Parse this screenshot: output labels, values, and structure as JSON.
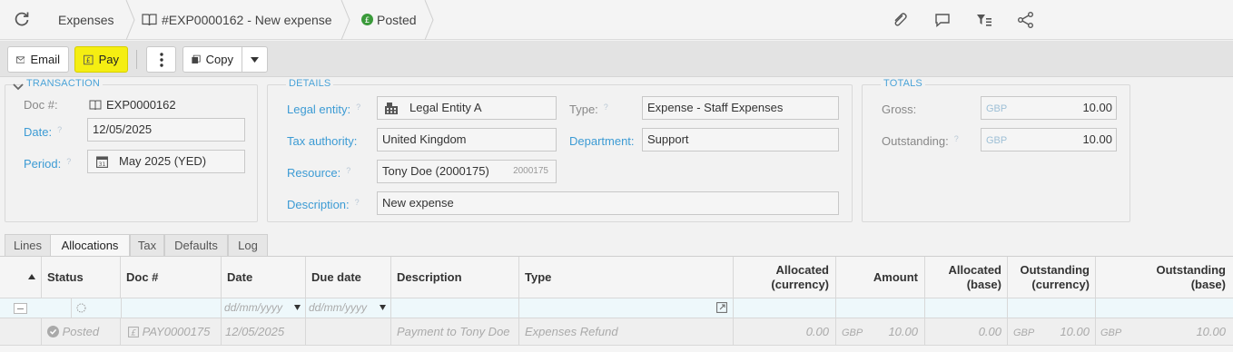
{
  "breadcrumb": {
    "section": "Expenses",
    "document": "#EXP0000162 - New expense",
    "status": "Posted"
  },
  "toolbar": {
    "email_label": "Email",
    "pay_label": "Pay",
    "copy_label": "Copy"
  },
  "transaction": {
    "legend": "TRANSACTION",
    "doc_label": "Doc #:",
    "doc_value": "EXP0000162",
    "date_label": "Date:",
    "date_value": "12/05/2025",
    "period_label": "Period:",
    "period_value": "May 2025 (YED)"
  },
  "details": {
    "legend": "DETAILS",
    "legal_entity_label": "Legal entity:",
    "legal_entity_value": "Legal Entity A",
    "tax_authority_label": "Tax authority:",
    "tax_authority_value": "United Kingdom",
    "resource_label": "Resource:",
    "resource_value": "Tony Doe (2000175)",
    "resource_code": "2000175",
    "description_label": "Description:",
    "description_value": "New expense",
    "type_label": "Type:",
    "type_value": "Expense - Staff Expenses",
    "department_label": "Department:",
    "department_value": "Support"
  },
  "totals": {
    "legend": "TOTALS",
    "gross_label": "Gross:",
    "gross_currency": "GBP",
    "gross_value": "10.00",
    "outstanding_label": "Outstanding:",
    "outstanding_currency": "GBP",
    "outstanding_value": "10.00"
  },
  "tabs": [
    "Lines",
    "Allocations",
    "Tax",
    "Defaults",
    "Log"
  ],
  "grid": {
    "headers": {
      "status": "Status",
      "doc": "Doc #",
      "date": "Date",
      "due_date": "Due date",
      "description": "Description",
      "type": "Type",
      "alloc_cur_1": "Allocated",
      "alloc_cur_2": "(currency)",
      "amount": "Amount",
      "alloc_base_1": "Allocated",
      "alloc_base_2": "(base)",
      "out_cur_1": "Outstanding",
      "out_cur_2": "(currency)",
      "out_base_1": "Outstanding",
      "out_base_2": "(base)"
    },
    "filter": {
      "date_placeholder": "dd/mm/yyyy",
      "due_placeholder": "dd/mm/yyyy"
    },
    "row": {
      "status": "Posted",
      "doc": "PAY0000175",
      "date": "12/05/2025",
      "description": "Payment to Tony Doe",
      "type": "Expenses Refund",
      "allocated_currency": "0.00",
      "amount_currency": "GBP",
      "amount": "10.00",
      "allocated_base": "0.00",
      "outstanding_currency_code": "GBP",
      "outstanding_currency": "10.00",
      "outstanding_base_code": "GBP",
      "outstanding_base": "10.00"
    }
  }
}
